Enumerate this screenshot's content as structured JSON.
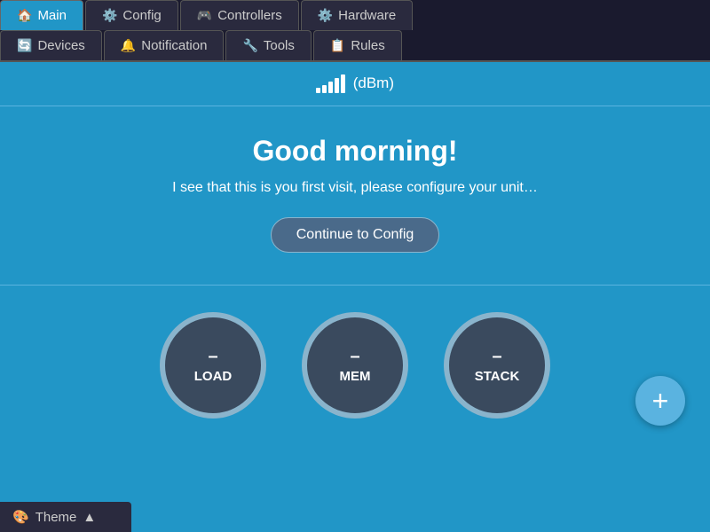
{
  "tabs": {
    "row1": [
      {
        "id": "main",
        "label": "Main",
        "icon": "🏠",
        "active": true
      },
      {
        "id": "config",
        "label": "Config",
        "icon": "⚙️"
      },
      {
        "id": "controllers",
        "label": "Controllers",
        "icon": "🎮"
      },
      {
        "id": "hardware",
        "label": "Hardware",
        "icon": "⚙️"
      }
    ],
    "row2": [
      {
        "id": "devices",
        "label": "Devices",
        "icon": "🔄"
      },
      {
        "id": "notification",
        "label": "Notification",
        "icon": "🔔"
      },
      {
        "id": "tools",
        "label": "Tools",
        "icon": "🔧"
      },
      {
        "id": "rules",
        "label": "Rules",
        "icon": "📋"
      }
    ]
  },
  "signal": {
    "label": "(dBm)"
  },
  "welcome": {
    "title": "Good morning!",
    "message": "I see that this is you first visit, please configure your unit…",
    "button_label": "Continue to Config"
  },
  "gauges": [
    {
      "id": "load",
      "value": "–",
      "label": "LOAD"
    },
    {
      "id": "mem",
      "value": "–",
      "label": "MEM"
    },
    {
      "id": "stack",
      "value": "–",
      "label": "STACK"
    }
  ],
  "fab": {
    "label": "+"
  },
  "theme_bar": {
    "icon": "🎨",
    "label": "Theme",
    "arrow": "▲"
  }
}
